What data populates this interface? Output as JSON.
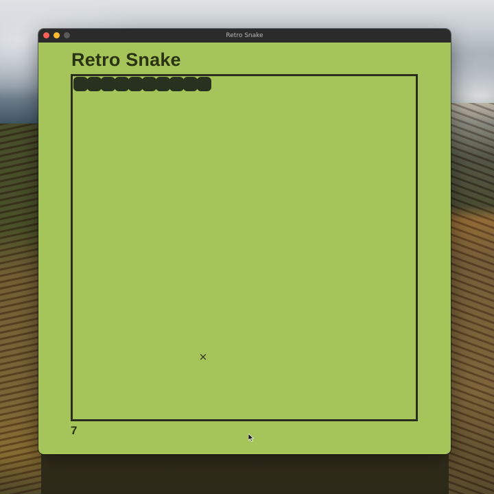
{
  "window": {
    "title": "Retro Snake"
  },
  "game": {
    "title": "Retro Snake",
    "score": "7",
    "food_icon": "×",
    "snake_length": 10
  },
  "colors": {
    "background": "#a5c55a",
    "snake": "#283020",
    "border": "#2a2d1e",
    "text": "#2a3312"
  }
}
